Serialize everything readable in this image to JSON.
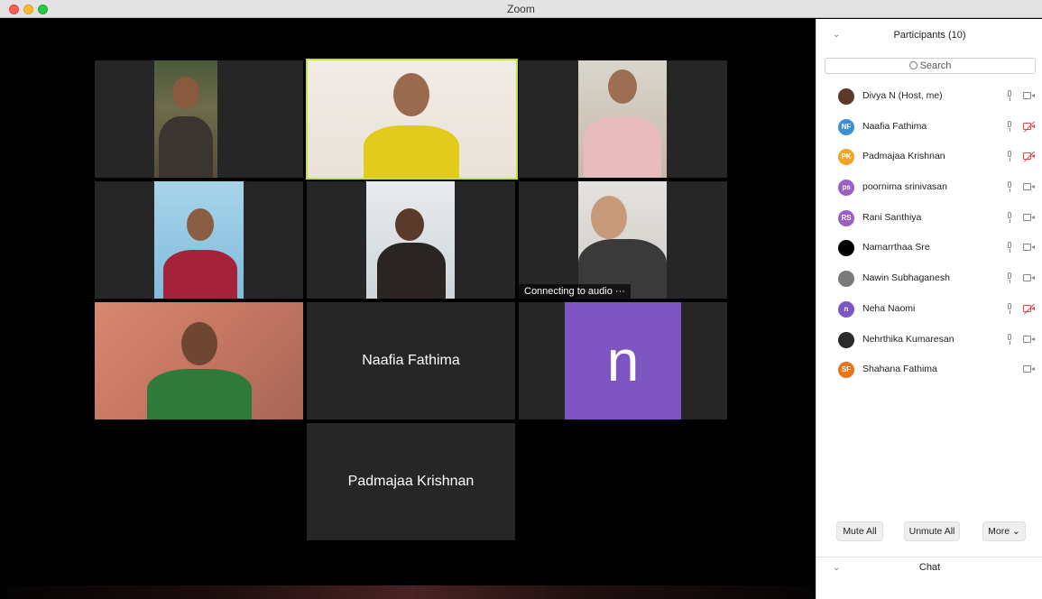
{
  "window": {
    "title": "Zoom"
  },
  "gallery": {
    "tiles": [
      {
        "name": "Naafia Fathima"
      },
      {
        "name": "Padmajaa Krishnan"
      },
      {
        "avatar_letter": "n"
      },
      {
        "status": "Connecting to audio ···"
      }
    ]
  },
  "participants": {
    "title": "Participants (10)",
    "search_placeholder": "Search",
    "list": [
      {
        "initials": "",
        "name": "Divya N (Host, me)",
        "avatar_color": "#5a3b2a",
        "mic": true,
        "video_off": false
      },
      {
        "initials": "NF",
        "name": "Naafia Fathima",
        "avatar_color": "#3a8fd6",
        "mic": true,
        "video_off": true
      },
      {
        "initials": "PK",
        "name": "Padmajaa Krishnan",
        "avatar_color": "#f0a428",
        "mic": true,
        "video_off": true
      },
      {
        "initials": "ps",
        "name": "poornima srinivasan",
        "avatar_color": "#9b5ec7",
        "mic": true,
        "video_off": false
      },
      {
        "initials": "RS",
        "name": "Rani Santhiya",
        "avatar_color": "#9b5ec7",
        "mic": true,
        "video_off": false
      },
      {
        "initials": "",
        "name": "Namarrthaa Sre",
        "avatar_color": "#000000",
        "mic": true,
        "video_off": false
      },
      {
        "initials": "",
        "name": "Nawin Subhaganesh",
        "avatar_color": "#7a7a7a",
        "mic": true,
        "video_off": false
      },
      {
        "initials": "n",
        "name": "Neha Naomi",
        "avatar_color": "#7e56c2",
        "mic": true,
        "video_off": true
      },
      {
        "initials": "",
        "name": "Nehrthika Kumaresan",
        "avatar_color": "#2a2a2a",
        "mic": true,
        "video_off": false
      },
      {
        "initials": "SF",
        "name": "Shahana Fathima",
        "avatar_color": "#e8731a",
        "mic": false,
        "video_off": false
      }
    ],
    "buttons": {
      "mute_all": "Mute All",
      "unmute_all": "Unmute All",
      "more": "More ⌄"
    }
  },
  "chat": {
    "title": "Chat"
  },
  "colors": {
    "active_speaker": "#c7e32d",
    "tile_bg": "#262626",
    "avatar_tile": "#7e56c2"
  }
}
